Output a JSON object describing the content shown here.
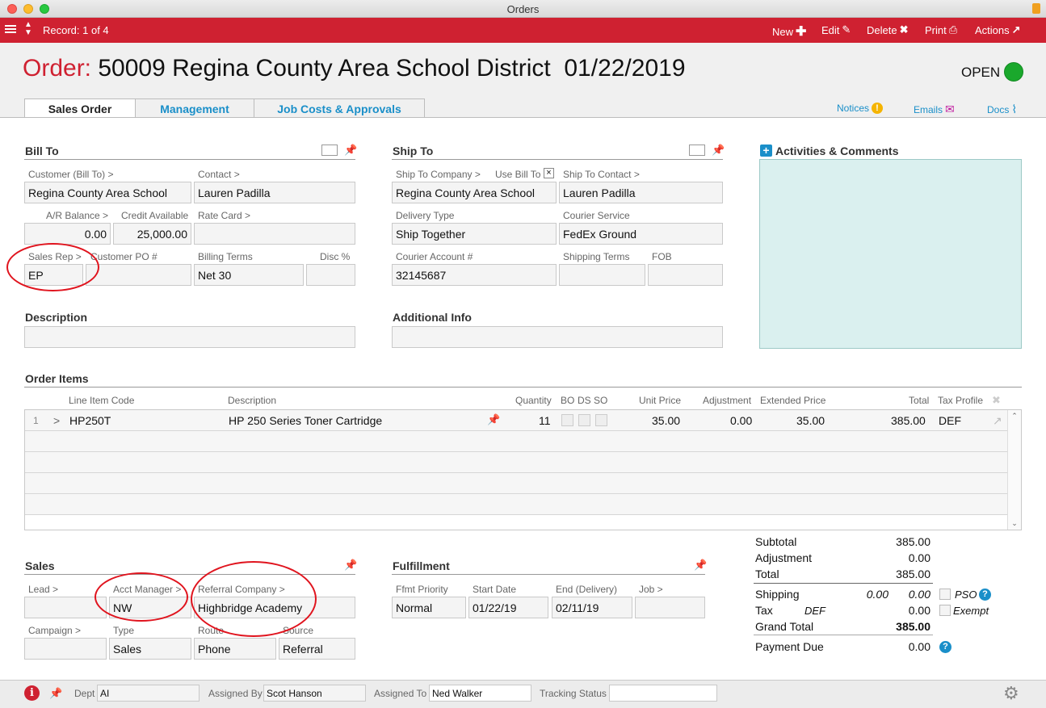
{
  "window": {
    "title": "Orders"
  },
  "toolbar": {
    "record": "Record: 1 of 4",
    "new": "New",
    "edit": "Edit",
    "delete": "Delete",
    "print": "Print",
    "actions": "Actions"
  },
  "header": {
    "order_label": "Order:",
    "order_title": "50009 Regina County Area School District  01/22/2019",
    "status": "OPEN",
    "status_color": "#1aa82c"
  },
  "tabs": [
    {
      "label": "Sales Order"
    },
    {
      "label": "Management"
    },
    {
      "label": "Job Costs & Approvals"
    }
  ],
  "toplinks": {
    "notices": "Notices",
    "emails": "Emails",
    "docs": "Docs"
  },
  "bill_to": {
    "title": "Bill To",
    "customer_label": "Customer (Bill To) >",
    "customer": "Regina County Area School",
    "contact_label": "Contact >",
    "contact": "Lauren Padilla",
    "ar_label": "A/R Balance >",
    "ar": "0.00",
    "credit_label": "Credit Available",
    "credit": "25,000.00",
    "ratecard_label": "Rate Card >",
    "ratecard": "",
    "salesrep_label": "Sales Rep >",
    "salesrep": "EP",
    "custpo_label": "Customer PO #",
    "custpo": "",
    "billing_label": "Billing Terms",
    "billing": "Net 30",
    "disc_label": "Disc %",
    "disc": ""
  },
  "ship_to": {
    "title": "Ship To",
    "company_label": "Ship To Company >",
    "company": "Regina County Area School",
    "usebill_label": "Use Bill To",
    "usebill_mark": "×",
    "contact_label": "Ship To Contact >",
    "contact": "Lauren Padilla",
    "delivery_label": "Delivery Type",
    "delivery": "Ship Together",
    "courier_label": "Courier Service",
    "courier": "FedEx Ground",
    "account_label": "Courier Account #",
    "account": "32145687",
    "shipterms_label": "Shipping Terms",
    "shipterms": "",
    "fob_label": "FOB",
    "fob": ""
  },
  "activities": {
    "title": "Activities & Comments",
    "bg": "#daf0ef"
  },
  "description": {
    "title": "Description",
    "value": ""
  },
  "additional": {
    "title": "Additional Info",
    "value": ""
  },
  "order_items": {
    "title": "Order Items",
    "headers": {
      "code": "Line Item Code",
      "desc": "Description",
      "qty": "Quantity",
      "bo": "BO",
      "ds": "DS",
      "so": "SO",
      "unit": "Unit Price",
      "adj": "Adjustment",
      "ext": "Extended Price",
      "total": "Total",
      "tax": "Tax Profile"
    },
    "rows": [
      {
        "num": "1",
        "arrow": ">",
        "code": "HP250T",
        "desc": "HP 250 Series Toner Cartridge",
        "qty": "11",
        "unit": "35.00",
        "adj": "0.00",
        "ext": "35.00",
        "total": "385.00",
        "tax": "DEF"
      }
    ]
  },
  "sales": {
    "title": "Sales",
    "lead_label": "Lead >",
    "lead": "",
    "acct_label": "Acct Manager >",
    "acct": "NW",
    "referral_label": "Referral Company >",
    "referral": "Highbridge Academy",
    "campaign_label": "Campaign >",
    "campaign": "",
    "type_label": "Type",
    "type": "Sales",
    "route_label": "Route",
    "route": "Phone",
    "source_label": "Source",
    "source": "Referral"
  },
  "fulfillment": {
    "title": "Fulfillment",
    "priority_label": "Ffmt Priority",
    "priority": "Normal",
    "start_label": "Start Date",
    "start": "01/22/19",
    "end_label": "End (Delivery)",
    "end": "02/11/19",
    "job_label": "Job >",
    "job": ""
  },
  "totals": {
    "subtotal_label": "Subtotal",
    "subtotal": "385.00",
    "adjustment_label": "Adjustment",
    "adjustment": "0.00",
    "total_label": "Total",
    "total": "385.00",
    "shipping_label": "Shipping",
    "shipping_a": "0.00",
    "shipping_b": "0.00",
    "pso": "PSO",
    "tax_label": "Tax",
    "tax_profile": "DEF",
    "tax": "0.00",
    "exempt": "Exempt",
    "grand_label": "Grand Total",
    "grand": "385.00",
    "due_label": "Payment Due",
    "due": "0.00"
  },
  "footer": {
    "dept_label": "Dept",
    "dept": "AI",
    "assigned_by_label": "Assigned By",
    "assigned_by": "Scot Hanson",
    "assigned_to_label": "Assigned To",
    "assigned_to": "Ned Walker",
    "tracking_label": "Tracking Status",
    "tracking": ""
  }
}
